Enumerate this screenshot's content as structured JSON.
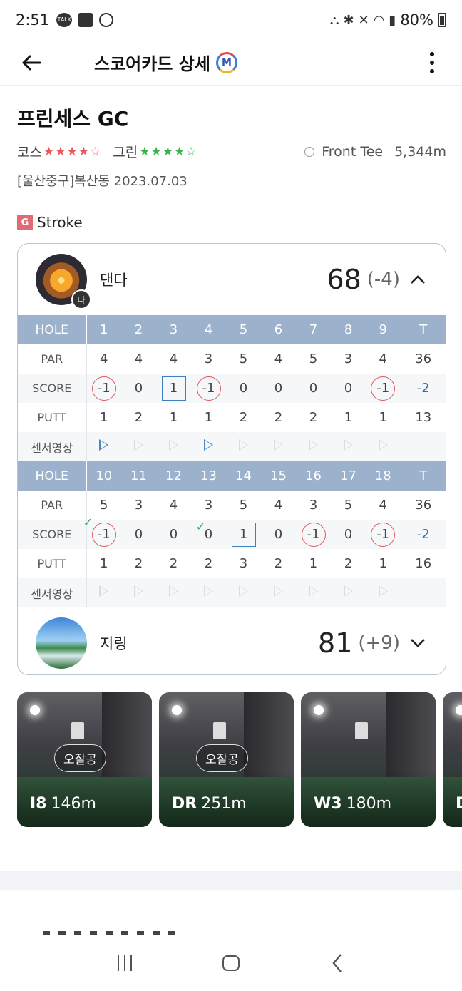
{
  "status_bar": {
    "time": "2:51",
    "battery": "80%",
    "left_icons": [
      "kakaotalk-icon",
      "gallery-icon",
      "app-icon"
    ],
    "right_icons": [
      "android-icon",
      "bluetooth-icon",
      "mute-icon",
      "wifi-icon",
      "signal-icon",
      "battery-icon"
    ]
  },
  "header": {
    "title": "스코어카드 상세",
    "badge": "M"
  },
  "course": {
    "name": "프린세스 GC",
    "course_label": "코스",
    "course_rating": 4,
    "green_label": "그린",
    "green_rating": 4,
    "rating_max": 5,
    "tee": "Front Tee",
    "length": "5,344m",
    "location_date": "[울산중구]복산동 2023.07.03"
  },
  "mode": {
    "badge": "G",
    "label": "Stroke"
  },
  "players": [
    {
      "name": "댄다",
      "badge": "나",
      "score": "68",
      "diff": "(-4)",
      "expanded": true
    },
    {
      "name": "지링",
      "score": "81",
      "diff": "(+9)",
      "expanded": false
    }
  ],
  "scorecard": {
    "labels": {
      "hole": "HOLE",
      "par": "PAR",
      "score": "SCORE",
      "putt": "PUTT",
      "video": "센서영상",
      "total": "T"
    },
    "front": {
      "holes": [
        "1",
        "2",
        "3",
        "4",
        "5",
        "6",
        "7",
        "8",
        "9"
      ],
      "par": [
        "4",
        "4",
        "4",
        "3",
        "5",
        "4",
        "5",
        "3",
        "4"
      ],
      "par_total": "36",
      "score": [
        "-1",
        "0",
        "1",
        "-1",
        "0",
        "0",
        "0",
        "0",
        "-1"
      ],
      "score_total": "-2",
      "putt": [
        "1",
        "2",
        "1",
        "1",
        "2",
        "2",
        "2",
        "1",
        "1"
      ],
      "putt_total": "13",
      "video": [
        true,
        false,
        false,
        true,
        false,
        false,
        false,
        false,
        false
      ]
    },
    "back": {
      "holes": [
        "10",
        "11",
        "12",
        "13",
        "14",
        "15",
        "16",
        "17",
        "18"
      ],
      "par": [
        "5",
        "3",
        "4",
        "3",
        "5",
        "4",
        "3",
        "5",
        "4"
      ],
      "par_total": "36",
      "score": [
        "-1",
        "0",
        "0",
        "0",
        "1",
        "0",
        "-1",
        "0",
        "-1"
      ],
      "score_total": "-2",
      "putt": [
        "1",
        "2",
        "2",
        "2",
        "3",
        "2",
        "1",
        "2",
        "1"
      ],
      "putt_total": "16",
      "checks": [
        true,
        false,
        false,
        true,
        false,
        false,
        false,
        false,
        false
      ],
      "video": [
        false,
        false,
        false,
        false,
        false,
        false,
        false,
        false,
        false
      ]
    }
  },
  "shots": [
    {
      "club": "I8",
      "distance": "146m",
      "tag": "오잘공"
    },
    {
      "club": "DR",
      "distance": "251m",
      "tag": "오잘공"
    },
    {
      "club": "W3",
      "distance": "180m",
      "tag": ""
    },
    {
      "club": "D",
      "distance": "",
      "tag": ""
    }
  ],
  "colors": {
    "accent_blue": "#2f6fb3",
    "hole_header": "#9bb1cc",
    "birdie_red": "#e2575a",
    "check_green": "#2fb24a",
    "star_red": "#e8575a",
    "star_green": "#36b24a"
  },
  "nav_icons": [
    "recent-apps-icon",
    "home-icon",
    "back-icon"
  ]
}
